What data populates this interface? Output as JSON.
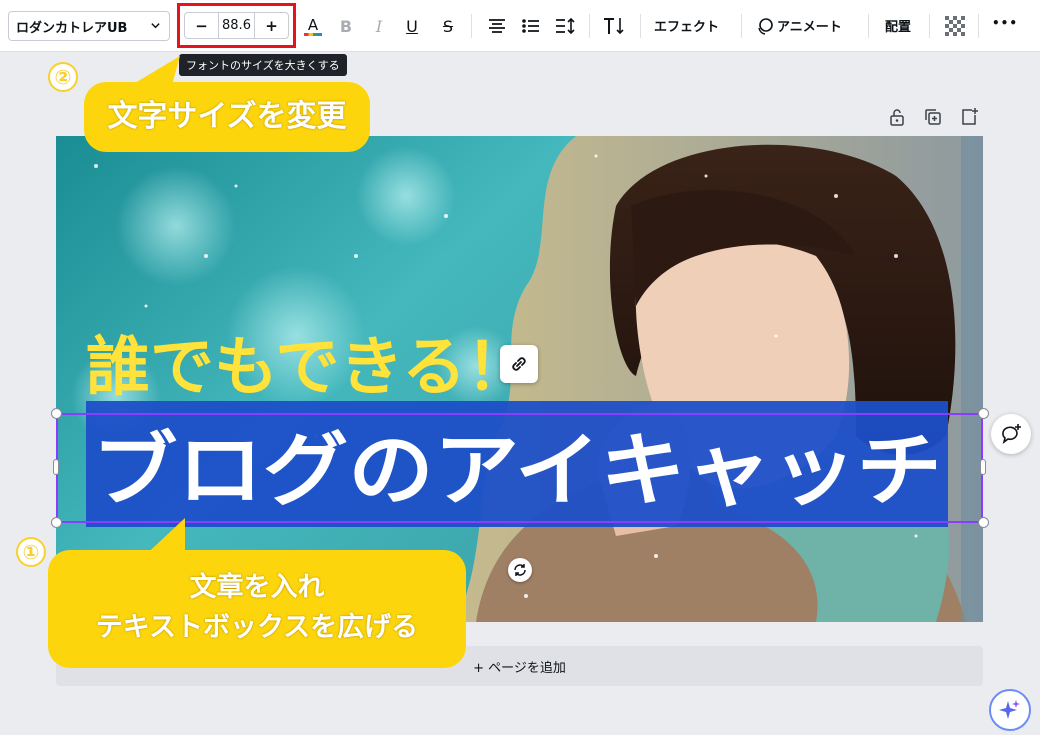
{
  "toolbar": {
    "font_name": "ロダンカトレアUB",
    "font_size": "88.6",
    "minus": "−",
    "plus": "+",
    "effects_label": "エフェクト",
    "animate_label": "アニメート",
    "position_label": "配置",
    "more_label": "•••"
  },
  "tooltip": "フォントのサイズを大きくする",
  "design": {
    "line1": "誰でもできる！",
    "line2": "ブログのアイキャッチ",
    "title_fill_color": "#ffffff",
    "line1_color": "#ffe23a",
    "highlight_color": "#1e4fc8"
  },
  "add_page_label": "+ ページを追加",
  "annotations": {
    "step1_number": "①",
    "step2_number": "②",
    "callout1_line1": "文章を入れ",
    "callout1_line2": "テキストボックスを広げる",
    "callout2": "文字サイズを変更",
    "accent_color": "#fcd50c",
    "highlight_border": "#e8121f"
  }
}
